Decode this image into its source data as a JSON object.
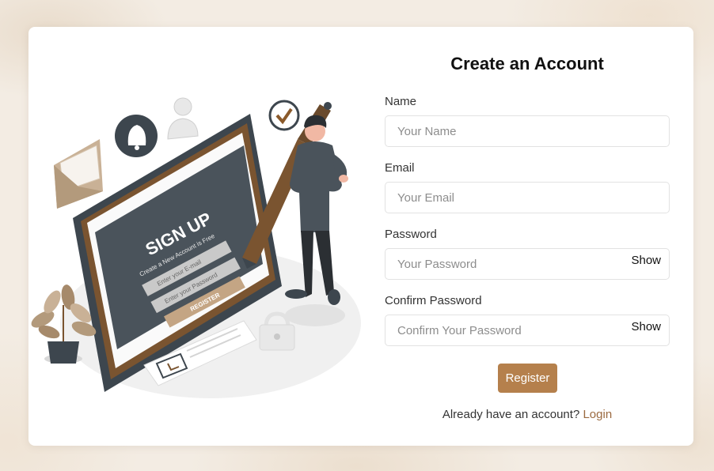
{
  "form": {
    "title": "Create an Account",
    "name_label": "Name",
    "name_placeholder": "Your Name",
    "email_label": "Email",
    "email_placeholder": "Your Email",
    "password_label": "Password",
    "password_placeholder": "Your Password",
    "password_toggle": "Show",
    "confirm_label": "Confirm Password",
    "confirm_placeholder": "Confirm Your Password",
    "confirm_toggle": "Show",
    "register_label": "Register",
    "login_prompt": "Already have an account?",
    "login_link": "Login"
  },
  "illustration": {
    "heading": "SIGN UP",
    "subheading": "Create a New Account is Free",
    "email_field": "Enter your E-mail",
    "password_field": "Enter your Password",
    "button": "REGISTER"
  },
  "colors": {
    "accent": "#b5804c",
    "link": "#9b6a40",
    "page_background": "#f3ece3"
  }
}
